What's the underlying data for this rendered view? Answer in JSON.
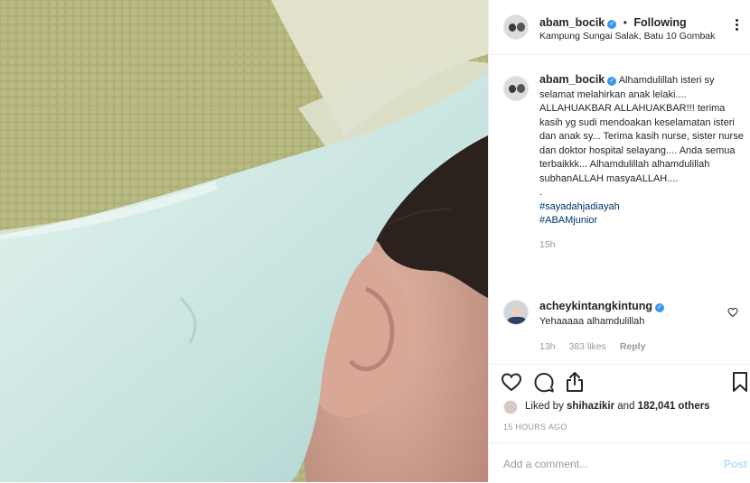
{
  "header": {
    "username": "abam_bocik",
    "separator": "•",
    "follow_state": "Following",
    "location": "Kampung Sungai Salak, Batu 10 Gombak"
  },
  "caption": {
    "username": "abam_bocik",
    "text": " Alhamdulillah isteri sy selamat melahirkan anak lelaki.... ALLAHUAKBAR ALLAHUAKBAR!!! terima kasih yg sudi mendoakan keselamatan isteri dan anak sy... Terima kasih nurse, sister nurse dan doktor hospital selayang.... Anda semua terbaikkk... Alhamdulillah alhamdulillah subhanALLAH masyaALLAH....\n.",
    "hashtags": [
      "#sayadahjadiayah",
      "#ABAMjunior"
    ],
    "age": "15h"
  },
  "comment": {
    "username": "acheykintangkintung",
    "text": "Yehaaaaa alhamdulillah",
    "age": "13h",
    "likes": "383 likes",
    "reply_label": "Reply"
  },
  "actions": {
    "like_icon": "heart-outline-icon",
    "comment_icon": "comment-bubble-icon",
    "share_icon": "share-upload-icon",
    "save_icon": "bookmark-icon"
  },
  "likes": {
    "prefix": "Liked by ",
    "user": "shihazikir",
    "middle": " and ",
    "count": "182,041 others"
  },
  "timestamp": "15 HOURS AGO",
  "add_comment": {
    "placeholder": "Add a comment...",
    "post_label": "Post"
  },
  "colors": {
    "verified": "#3897f0",
    "hashtag": "#003569",
    "post_disabled": "#b2dffc",
    "muted": "#999999"
  }
}
